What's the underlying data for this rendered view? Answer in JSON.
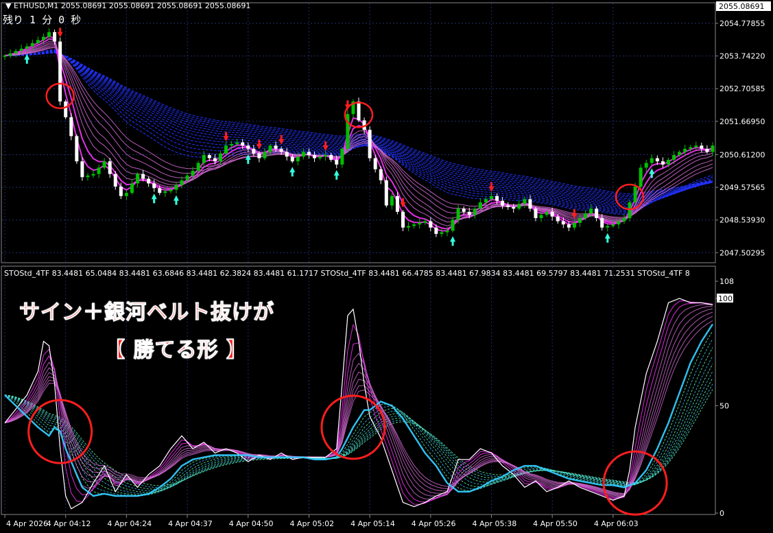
{
  "window": {
    "symbol_title": "ETHUSD,M1",
    "ohlc": "2055.08691 2055.08691 2055.08691 2055.08691",
    "timer_text": "残り 1 分 0 秒"
  },
  "indicator": {
    "header": "STOStd_4TF 83.4481 65.0484 83.4481 63.6846 83.4481 62.3824 83.4481 61.1717   STOStd_4TF 83.4481 66.4785 83.4481 67.9834 83.4481 69.5797 83.4481 71.2531   STOStd_4TF 8"
  },
  "annotation": {
    "line1": "サイン＋銀河ベルト抜けが",
    "line2": "【 勝てる形 】"
  },
  "colors": {
    "background": "#000000",
    "grid": "#1f2d6b",
    "bull_candle": "#00c000",
    "bear_candle": "#ffffff",
    "magenta": "#ff33ff",
    "purple": "#cc66cc",
    "blue_band": "#2233ff",
    "cyan": "#33ccff",
    "green_dash": "#66ffaa",
    "circle": "#ff1e1e",
    "sell_arrow": "#ff1e1e",
    "buy_arrow": "#33ffdd"
  },
  "chart_data": [
    {
      "type": "candlestick",
      "symbol": "ETHUSD",
      "timeframe": "M1",
      "current_price_label": "2055.08691",
      "y_ticks": [
        "2054.77855",
        "2053.74220",
        "2052.70585",
        "2051.66950",
        "2050.61200",
        "2049.57565",
        "2048.53930",
        "2047.50295"
      ],
      "y_tick_values": [
        2054.77855,
        2053.7422,
        2052.70585,
        2051.6695,
        2050.612,
        2049.57565,
        2048.5393,
        2047.50295
      ],
      "ylim": [
        2047.25,
        2055.3
      ],
      "close_path": [
        [
          0,
          2053.75
        ],
        [
          2,
          2053.9
        ],
        [
          4,
          2054.05
        ],
        [
          6,
          2054.25
        ],
        [
          7,
          2054.35
        ],
        [
          8,
          2054.5
        ],
        [
          9,
          2054.2
        ],
        [
          10,
          2052.3
        ],
        [
          11,
          2051.8
        ],
        [
          12,
          2051.2
        ],
        [
          13,
          2050.4
        ],
        [
          14,
          2049.9
        ],
        [
          16,
          2050.0
        ],
        [
          18,
          2050.4
        ],
        [
          20,
          2049.6
        ],
        [
          21,
          2049.3
        ],
        [
          22,
          2049.4
        ],
        [
          24,
          2050.0
        ],
        [
          26,
          2049.7
        ],
        [
          28,
          2049.4
        ],
        [
          30,
          2049.5
        ],
        [
          32,
          2049.8
        ],
        [
          34,
          2050.1
        ],
        [
          36,
          2050.6
        ],
        [
          38,
          2050.4
        ],
        [
          40,
          2050.9
        ],
        [
          42,
          2051.0
        ],
        [
          44,
          2050.8
        ],
        [
          46,
          2050.5
        ],
        [
          48,
          2050.9
        ],
        [
          50,
          2050.7
        ],
        [
          52,
          2050.4
        ],
        [
          54,
          2050.7
        ],
        [
          56,
          2050.5
        ],
        [
          58,
          2050.6
        ],
        [
          60,
          2050.3
        ],
        [
          61,
          2050.8
        ],
        [
          62,
          2051.9
        ],
        [
          63,
          2052.3
        ],
        [
          64,
          2051.7
        ],
        [
          65,
          2051.4
        ],
        [
          66,
          2050.5
        ],
        [
          68,
          2049.8
        ],
        [
          69,
          2049.0
        ],
        [
          70,
          2049.3
        ],
        [
          72,
          2048.3
        ],
        [
          74,
          2048.4
        ],
        [
          76,
          2048.5
        ],
        [
          78,
          2048.1
        ],
        [
          80,
          2048.2
        ],
        [
          82,
          2048.9
        ],
        [
          84,
          2048.7
        ],
        [
          86,
          2049.1
        ],
        [
          88,
          2049.3
        ],
        [
          90,
          2049.0
        ],
        [
          92,
          2048.9
        ],
        [
          94,
          2049.2
        ],
        [
          96,
          2048.6
        ],
        [
          98,
          2048.8
        ],
        [
          100,
          2048.5
        ],
        [
          102,
          2048.3
        ],
        [
          104,
          2048.6
        ],
        [
          106,
          2048.9
        ],
        [
          108,
          2048.3
        ],
        [
          110,
          2048.4
        ],
        [
          112,
          2048.6
        ],
        [
          113,
          2049.1
        ],
        [
          114,
          2049.6
        ],
        [
          115,
          2050.2
        ],
        [
          117,
          2050.5
        ],
        [
          119,
          2050.3
        ],
        [
          121,
          2050.6
        ],
        [
          123,
          2050.8
        ],
        [
          125,
          2050.9
        ],
        [
          127,
          2050.7
        ],
        [
          128,
          2050.9
        ]
      ],
      "sell_signal_indices": [
        10,
        40,
        46,
        50,
        58,
        62,
        72,
        88,
        103
      ],
      "buy_signal_indices": [
        4,
        27,
        31,
        44,
        52,
        60,
        81,
        109,
        117
      ],
      "highlight_circles": [
        {
          "label": "sell signal at top",
          "index": 10
        },
        {
          "label": "sell signal after spike",
          "index": 64
        },
        {
          "label": "buy signal breakout",
          "index": 113
        }
      ]
    },
    {
      "type": "line",
      "name": "STOStd_4TF",
      "ylim": [
        0,
        108
      ],
      "y_ticks": [
        "108",
        "100",
        "50",
        "0"
      ],
      "y_tick_values": [
        108,
        100,
        50,
        0
      ],
      "x_labels": [
        "4 Apr 2026",
        "4 Apr 04:12",
        "4 Apr 04:24",
        "4 Apr 04:37",
        "4 Apr 04:50",
        "4 Apr 05:02",
        "4 Apr 05:14",
        "4 Apr 05:26",
        "4 Apr 05:38",
        "4 Apr 05:50",
        "4 Apr 06:03"
      ],
      "fast_path": [
        [
          0,
          42
        ],
        [
          4,
          55
        ],
        [
          6,
          66
        ],
        [
          7,
          80
        ],
        [
          8,
          78
        ],
        [
          9,
          60
        ],
        [
          10,
          30
        ],
        [
          11,
          8
        ],
        [
          12,
          2
        ],
        [
          14,
          5
        ],
        [
          16,
          14
        ],
        [
          18,
          22
        ],
        [
          20,
          10
        ],
        [
          22,
          18
        ],
        [
          24,
          12
        ],
        [
          26,
          18
        ],
        [
          28,
          22
        ],
        [
          30,
          30
        ],
        [
          32,
          36
        ],
        [
          34,
          30
        ],
        [
          36,
          33
        ],
        [
          38,
          28
        ],
        [
          40,
          30
        ],
        [
          42,
          28
        ],
        [
          44,
          24
        ],
        [
          46,
          27
        ],
        [
          48,
          25
        ],
        [
          50,
          28
        ],
        [
          52,
          25
        ],
        [
          54,
          26
        ],
        [
          56,
          26
        ],
        [
          58,
          26
        ],
        [
          60,
          30
        ],
        [
          61,
          60
        ],
        [
          62,
          92
        ],
        [
          63,
          95
        ],
        [
          64,
          80
        ],
        [
          65,
          60
        ],
        [
          66,
          45
        ],
        [
          68,
          35
        ],
        [
          70,
          20
        ],
        [
          72,
          5
        ],
        [
          74,
          3
        ],
        [
          76,
          5
        ],
        [
          78,
          8
        ],
        [
          80,
          10
        ],
        [
          82,
          25
        ],
        [
          84,
          25
        ],
        [
          86,
          30
        ],
        [
          88,
          28
        ],
        [
          90,
          22
        ],
        [
          92,
          18
        ],
        [
          94,
          12
        ],
        [
          96,
          15
        ],
        [
          98,
          10
        ],
        [
          100,
          12
        ],
        [
          102,
          15
        ],
        [
          104,
          12
        ],
        [
          106,
          10
        ],
        [
          108,
          8
        ],
        [
          110,
          6
        ],
        [
          112,
          8
        ],
        [
          113,
          20
        ],
        [
          114,
          40
        ],
        [
          116,
          65
        ],
        [
          118,
          80
        ],
        [
          120,
          98
        ],
        [
          122,
          100
        ],
        [
          124,
          98
        ],
        [
          126,
          98
        ],
        [
          128,
          97
        ]
      ],
      "slow_path": [
        [
          0,
          55
        ],
        [
          4,
          45
        ],
        [
          6,
          40
        ],
        [
          8,
          36
        ],
        [
          9,
          40
        ],
        [
          10,
          38
        ],
        [
          11,
          30
        ],
        [
          12,
          24
        ],
        [
          14,
          12
        ],
        [
          16,
          8
        ],
        [
          18,
          9
        ],
        [
          20,
          8
        ],
        [
          22,
          8
        ],
        [
          24,
          8
        ],
        [
          26,
          9
        ],
        [
          28,
          12
        ],
        [
          30,
          16
        ],
        [
          32,
          22
        ],
        [
          34,
          25
        ],
        [
          36,
          26
        ],
        [
          38,
          27
        ],
        [
          40,
          27
        ],
        [
          42,
          27
        ],
        [
          44,
          27
        ],
        [
          46,
          26
        ],
        [
          48,
          26
        ],
        [
          50,
          26
        ],
        [
          52,
          26
        ],
        [
          54,
          26
        ],
        [
          56,
          25
        ],
        [
          58,
          25
        ],
        [
          60,
          26
        ],
        [
          61,
          30
        ],
        [
          62,
          35
        ],
        [
          63,
          40
        ],
        [
          64,
          44
        ],
        [
          65,
          48
        ],
        [
          66,
          48
        ],
        [
          68,
          52
        ],
        [
          70,
          50
        ],
        [
          72,
          44
        ],
        [
          74,
          36
        ],
        [
          76,
          28
        ],
        [
          78,
          22
        ],
        [
          80,
          14
        ],
        [
          82,
          10
        ],
        [
          84,
          10
        ],
        [
          86,
          12
        ],
        [
          88,
          15
        ],
        [
          90,
          17
        ],
        [
          92,
          20
        ],
        [
          94,
          22
        ],
        [
          96,
          22
        ],
        [
          98,
          20
        ],
        [
          100,
          18
        ],
        [
          102,
          16
        ],
        [
          104,
          15
        ],
        [
          106,
          14
        ],
        [
          108,
          13
        ],
        [
          110,
          13
        ],
        [
          112,
          12
        ],
        [
          114,
          14
        ],
        [
          116,
          20
        ],
        [
          118,
          30
        ],
        [
          120,
          42
        ],
        [
          122,
          56
        ],
        [
          124,
          70
        ],
        [
          126,
          80
        ],
        [
          128,
          88
        ]
      ],
      "highlight_circles": [
        {
          "label": "cross 1",
          "index": 10
        },
        {
          "label": "cross 2",
          "index": 63
        },
        {
          "label": "cross 3",
          "index": 114
        }
      ]
    }
  ]
}
